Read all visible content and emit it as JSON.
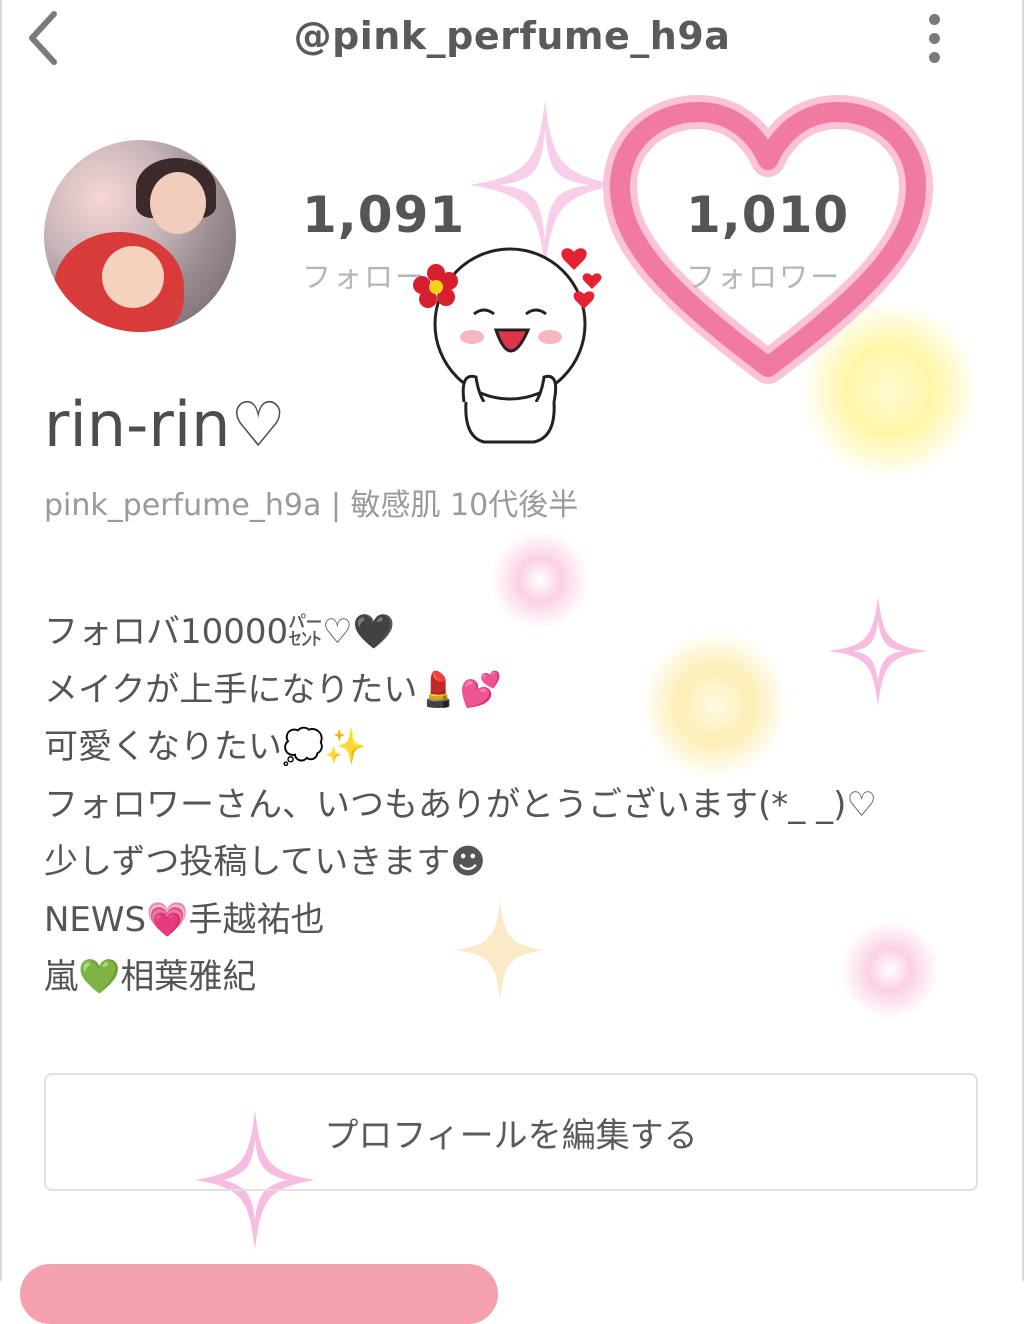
{
  "header": {
    "back_icon": "chevron-left-icon",
    "username": "@pink_perfume_h9a",
    "more_icon": "vertical-dots-icon"
  },
  "profile": {
    "avatar_alt": "",
    "stats": [
      {
        "count": "1,091",
        "label": "フォロー"
      },
      {
        "count": "1,010",
        "label": "フォロワー"
      }
    ],
    "display_name": "rin-rin♡",
    "subtitle": "pink_perfume_h9a | 敏感肌  10代後半",
    "bio_lines": [
      "フォロバ10000㌫♡🖤",
      "メイクが上手になりたい💄💕",
      "可愛くなりたい💭✨",
      "フォロワーさん、いつもありがとうございます(*_ _)♡",
      "少しずつ投稿していきます☻",
      "NEWS💗手越祐也",
      "嵐💚相葉雅紀"
    ]
  },
  "actions": {
    "edit_profile_label": "プロフィールを編集する"
  },
  "colors": {
    "accent_pink": "#f07aa0",
    "bar_pink": "#f2a1ad",
    "text_dark": "#4a4a4a",
    "text_muted": "#b5b5b5"
  }
}
